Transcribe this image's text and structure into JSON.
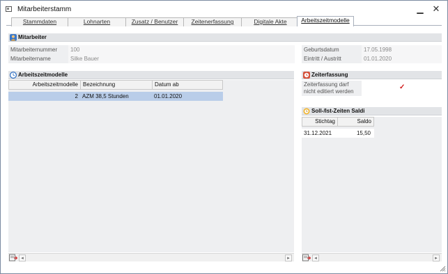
{
  "window": {
    "title": "Mitarbeiterstamm",
    "minimize_symbol": "▁",
    "close_symbol": "✕"
  },
  "tabs": [
    {
      "label": "Stammdaten",
      "active": false
    },
    {
      "label": "Lohnarten",
      "active": false
    },
    {
      "label": "Zusatz / Benutzer",
      "active": false
    },
    {
      "label": "Zeitenerfassung",
      "active": false
    },
    {
      "label": "Digitale Akte",
      "active": false
    },
    {
      "label": "Arbeitszeitmodelle",
      "active": true
    }
  ],
  "mitarbeiter": {
    "header": "Mitarbeiter",
    "icon": "person-icon",
    "fields": {
      "nummer_label": "Mitarbeiternummer",
      "nummer_value": "100",
      "name_label": "Mitarbeitername",
      "name_value": "Silke Bauer",
      "geburtsdatum_label": "Geburtsdatum",
      "geburtsdatum_value": "17.05.1998",
      "eintritt_label": "Eintritt / Austritt",
      "eintritt_value": "01.01.2020"
    }
  },
  "arbeitszeitmodelle": {
    "header": "Arbeitszeitmodelle",
    "icon": "clock-icon",
    "columns": [
      "Arbeitszeitmodelle",
      "Bezeichnung",
      "Datum ab"
    ],
    "rows": [
      {
        "modell": "2",
        "bezeichnung": "AZM 38,5 Stunden",
        "datum": "01.01.2020"
      }
    ]
  },
  "zeiterfassung": {
    "header": "Zeiterfassung",
    "icon": "clock-edit-icon",
    "label": "Zeiterfassung darf nicht editiert werden",
    "checked": true,
    "check_symbol": "✓"
  },
  "saldi": {
    "header": "Soll-/Ist-Zeiten Saldi",
    "icon": "sun-clock-icon",
    "columns": [
      "Stichtag",
      "Saldo"
    ],
    "rows": [
      {
        "stichtag": "31.12.2021",
        "saldo": "15,50"
      }
    ]
  },
  "scroll": {
    "left_arrow": "◂",
    "right_arrow": "▸"
  },
  "colors": {
    "selected_row": "#b9cde9",
    "section_header": "#e2e4e7",
    "check_red": "#d01818"
  }
}
